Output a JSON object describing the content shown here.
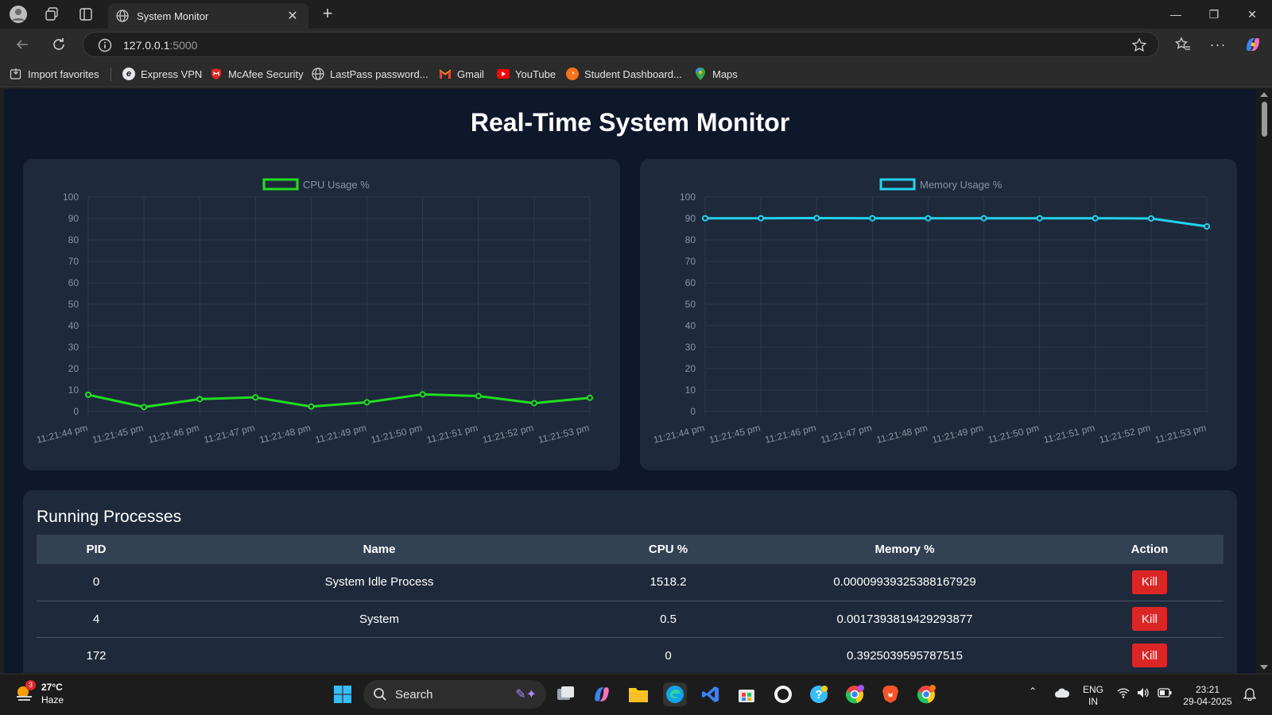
{
  "browser": {
    "tab_title": "System Monitor",
    "url_host": "127.0.0.1",
    "url_port": ":5000",
    "bookmarks": [
      {
        "label": "Import favorites",
        "icon": "import-icon"
      },
      {
        "label": "Express VPN",
        "icon": "expressvpn-icon"
      },
      {
        "label": "McAfee Security",
        "icon": "mcafee-icon"
      },
      {
        "label": "LastPass password...",
        "icon": "globe-icon"
      },
      {
        "label": "Gmail",
        "icon": "gmail-icon"
      },
      {
        "label": "YouTube",
        "icon": "youtube-icon"
      },
      {
        "label": "Student Dashboard...",
        "icon": "dashboard-icon"
      },
      {
        "label": "Maps",
        "icon": "maps-icon"
      }
    ]
  },
  "page": {
    "title": "Real-Time System Monitor"
  },
  "chart_data": [
    {
      "type": "line",
      "legend": "CPU Usage %",
      "color": "#22dd22",
      "x": [
        "11:21:44 pm",
        "11:21:45 pm",
        "11:21:46 pm",
        "11:21:47 pm",
        "11:21:48 pm",
        "11:21:49 pm",
        "11:21:50 pm",
        "11:21:51 pm",
        "11:21:52 pm",
        "11:21:53 pm"
      ],
      "values": [
        7.8,
        2.1,
        5.8,
        6.6,
        2.3,
        4.3,
        8.0,
        7.2,
        3.9,
        6.4
      ],
      "ylim": [
        0,
        100
      ],
      "yticks": [
        0,
        10,
        20,
        30,
        40,
        50,
        60,
        70,
        80,
        90,
        100
      ],
      "legend_position": "top-center",
      "grid": true
    },
    {
      "type": "line",
      "legend": "Memory Usage %",
      "color": "#22d3ee",
      "x": [
        "11:21:44 pm",
        "11:21:45 pm",
        "11:21:46 pm",
        "11:21:47 pm",
        "11:21:48 pm",
        "11:21:49 pm",
        "11:21:50 pm",
        "11:21:51 pm",
        "11:21:52 pm",
        "11:21:53 pm"
      ],
      "values": [
        90.1,
        90.1,
        90.2,
        90.1,
        90.1,
        90.1,
        90.1,
        90.1,
        90.0,
        86.3
      ],
      "ylim": [
        0,
        100
      ],
      "yticks": [
        0,
        10,
        20,
        30,
        40,
        50,
        60,
        70,
        80,
        90,
        100
      ],
      "legend_position": "top-center",
      "grid": true
    }
  ],
  "processes": {
    "title": "Running Processes",
    "columns": [
      "PID",
      "Name",
      "CPU %",
      "Memory %",
      "Action"
    ],
    "rows": [
      {
        "pid": "0",
        "name": "System Idle Process",
        "cpu": "1518.2",
        "mem": "0.00009939325388167929",
        "action": "Kill"
      },
      {
        "pid": "4",
        "name": "System",
        "cpu": "0.5",
        "mem": "0.0017393819429293877",
        "action": "Kill"
      },
      {
        "pid": "172",
        "name": "",
        "cpu": "0",
        "mem": "0.3925039595787515",
        "action": "Kill"
      }
    ]
  },
  "taskbar": {
    "weather_badge": "3",
    "temperature": "27°C",
    "condition": "Haze",
    "search_label": "Search",
    "lang_line1": "ENG",
    "lang_line2": "IN",
    "time": "23:21",
    "date": "29-04-2025"
  }
}
